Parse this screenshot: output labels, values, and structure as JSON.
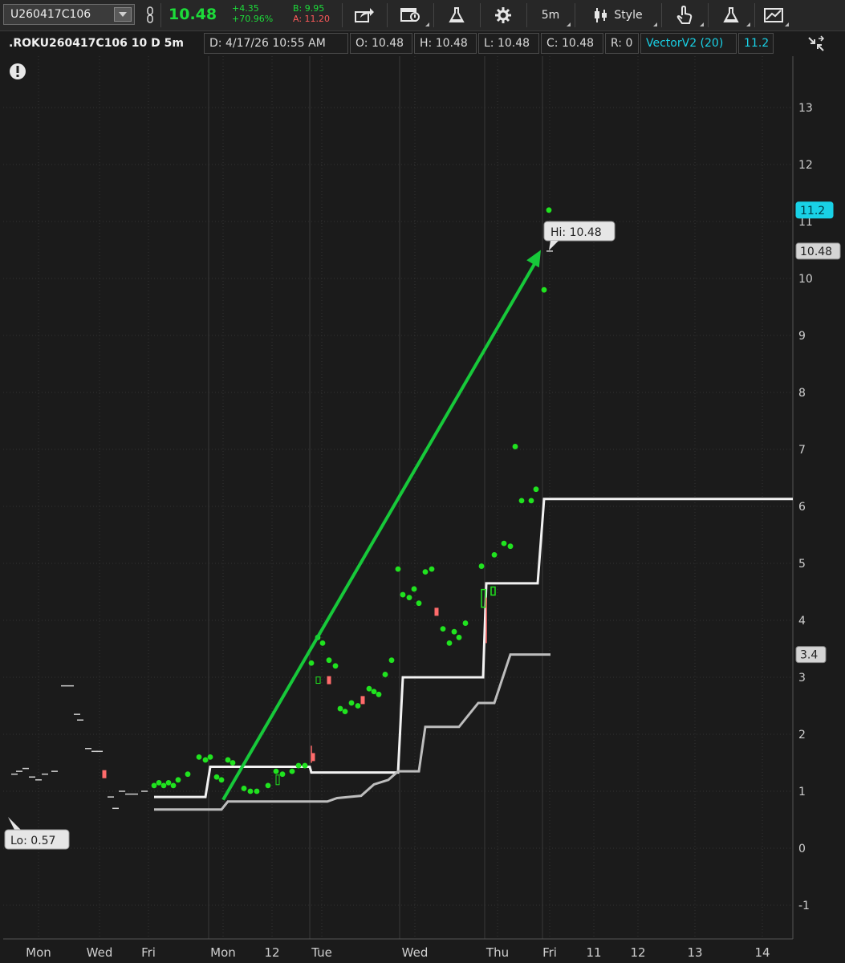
{
  "toolbar": {
    "symbol": "U260417C106",
    "last": "10.48",
    "net_change": "+4.35",
    "pct_change": "+70.96%",
    "bid": "B: 9.95",
    "ask": "A: 11.20",
    "interval": "5m",
    "style_label": "Style",
    "colors": {
      "up": "#1ddb3a",
      "ask": "#ff5a5a"
    }
  },
  "header": {
    "title": ".ROKU260417C106 10 D 5m",
    "date": "D: 4/17/26 10:55 AM",
    "open": "O: 10.48",
    "high": "H: 10.48",
    "low": "L: 10.48",
    "close": "C: 10.48",
    "range": "R: 0",
    "study": "VectorV2 (20)",
    "study_value": "11.2",
    "study_color": "#19d1e6"
  },
  "chart_data": {
    "type": "scatter",
    "y_ticks": [
      "13",
      "12",
      "11",
      "10",
      "9",
      "8",
      "7",
      "6",
      "5",
      "4",
      "3",
      "2",
      "1",
      "0",
      "-1"
    ],
    "y_range": [
      -1.5,
      13.8
    ],
    "x_labels": [
      "Mon",
      "Wed",
      "Fri",
      "Mon",
      "12",
      "Tue",
      "Wed",
      "Thu",
      "Fri",
      "11",
      "12",
      "13",
      "14"
    ],
    "price_markers": [
      {
        "label": "11.2",
        "value": 11.2,
        "style": "cyan"
      },
      {
        "label": "10.48",
        "value": 10.48,
        "style": "gray"
      },
      {
        "label": "3.4",
        "value": 3.4,
        "style": "gray"
      }
    ],
    "annotations": {
      "hi": "Hi: 10.48",
      "lo": "Lo: 0.57"
    },
    "series": [
      {
        "name": "",
        "role": "price",
        "points": [
          [
            1.3,
            "dash"
          ],
          [
            1.35,
            "dash"
          ],
          [
            1.4,
            "dash"
          ],
          [
            1.25,
            "dash"
          ],
          [
            1.2,
            "dash"
          ],
          [
            1.3,
            "dash"
          ],
          [
            1.35,
            "dash"
          ],
          [
            2.85,
            "dash"
          ],
          [
            2.85,
            "dash"
          ],
          [
            2.35,
            "dash"
          ],
          [
            2.25,
            "dash"
          ],
          [
            1.75,
            "dash"
          ],
          [
            1.7,
            "dash"
          ],
          [
            1.7,
            "dash"
          ],
          [
            1.3,
            "red"
          ],
          [
            0.9,
            "dash"
          ],
          [
            0.7,
            "dash"
          ],
          [
            1.0,
            "dash"
          ],
          [
            0.95,
            "dash"
          ],
          [
            0.95,
            "dash"
          ],
          [
            1.0,
            "dash"
          ],
          [
            1.1,
            "green"
          ],
          [
            1.15,
            "green"
          ],
          [
            1.1,
            "green"
          ],
          [
            1.15,
            "green"
          ],
          [
            1.1,
            "green"
          ],
          [
            1.2,
            "green"
          ],
          [
            1.3,
            "green"
          ],
          [
            1.6,
            "green"
          ],
          [
            1.55,
            "green"
          ],
          [
            1.6,
            "green"
          ],
          [
            1.25,
            "green"
          ],
          [
            1.2,
            "green"
          ],
          [
            1.55,
            "green"
          ],
          [
            1.5,
            "green"
          ],
          [
            1.05,
            "green"
          ],
          [
            1.0,
            "green"
          ],
          [
            1.0,
            "green"
          ],
          [
            1.1,
            "green"
          ],
          [
            1.35,
            "green"
          ],
          [
            1.3,
            "green"
          ],
          [
            1.35,
            "green"
          ],
          [
            1.45,
            "green"
          ],
          [
            1.45,
            "green"
          ],
          [
            1.6,
            "red"
          ],
          [
            3.25,
            "green"
          ],
          [
            3.7,
            "green"
          ],
          [
            3.6,
            "green"
          ],
          [
            3.3,
            "green"
          ],
          [
            2.95,
            "red"
          ],
          [
            3.2,
            "green"
          ],
          [
            2.45,
            "green"
          ],
          [
            2.4,
            "green"
          ],
          [
            2.55,
            "green"
          ],
          [
            2.5,
            "green"
          ],
          [
            2.6,
            "red"
          ],
          [
            2.8,
            "green"
          ],
          [
            2.75,
            "green"
          ],
          [
            2.7,
            "green"
          ],
          [
            3.05,
            "green"
          ],
          [
            3.3,
            "green"
          ],
          [
            4.9,
            "green"
          ],
          [
            4.45,
            "green"
          ],
          [
            4.4,
            "green"
          ],
          [
            4.55,
            "green"
          ],
          [
            4.3,
            "green"
          ],
          [
            4.85,
            "green"
          ],
          [
            4.9,
            "green"
          ],
          [
            4.15,
            "red"
          ],
          [
            3.85,
            "green"
          ],
          [
            3.6,
            "green"
          ],
          [
            3.8,
            "green"
          ],
          [
            3.7,
            "green"
          ],
          [
            3.95,
            "green"
          ],
          [
            4.95,
            "green"
          ],
          [
            5.15,
            "green"
          ],
          [
            5.35,
            "green"
          ],
          [
            5.3,
            "green"
          ],
          [
            7.05,
            "green"
          ],
          [
            6.1,
            "green"
          ],
          [
            6.1,
            "green"
          ],
          [
            6.3,
            "green"
          ],
          [
            11.2,
            "green"
          ],
          [
            9.8,
            "green"
          ],
          [
            10.48,
            "dash"
          ]
        ]
      }
    ],
    "arrow": {
      "from": [
        0.85,
        "Mon"
      ],
      "to": [
        10.48,
        "Fri"
      ]
    }
  }
}
